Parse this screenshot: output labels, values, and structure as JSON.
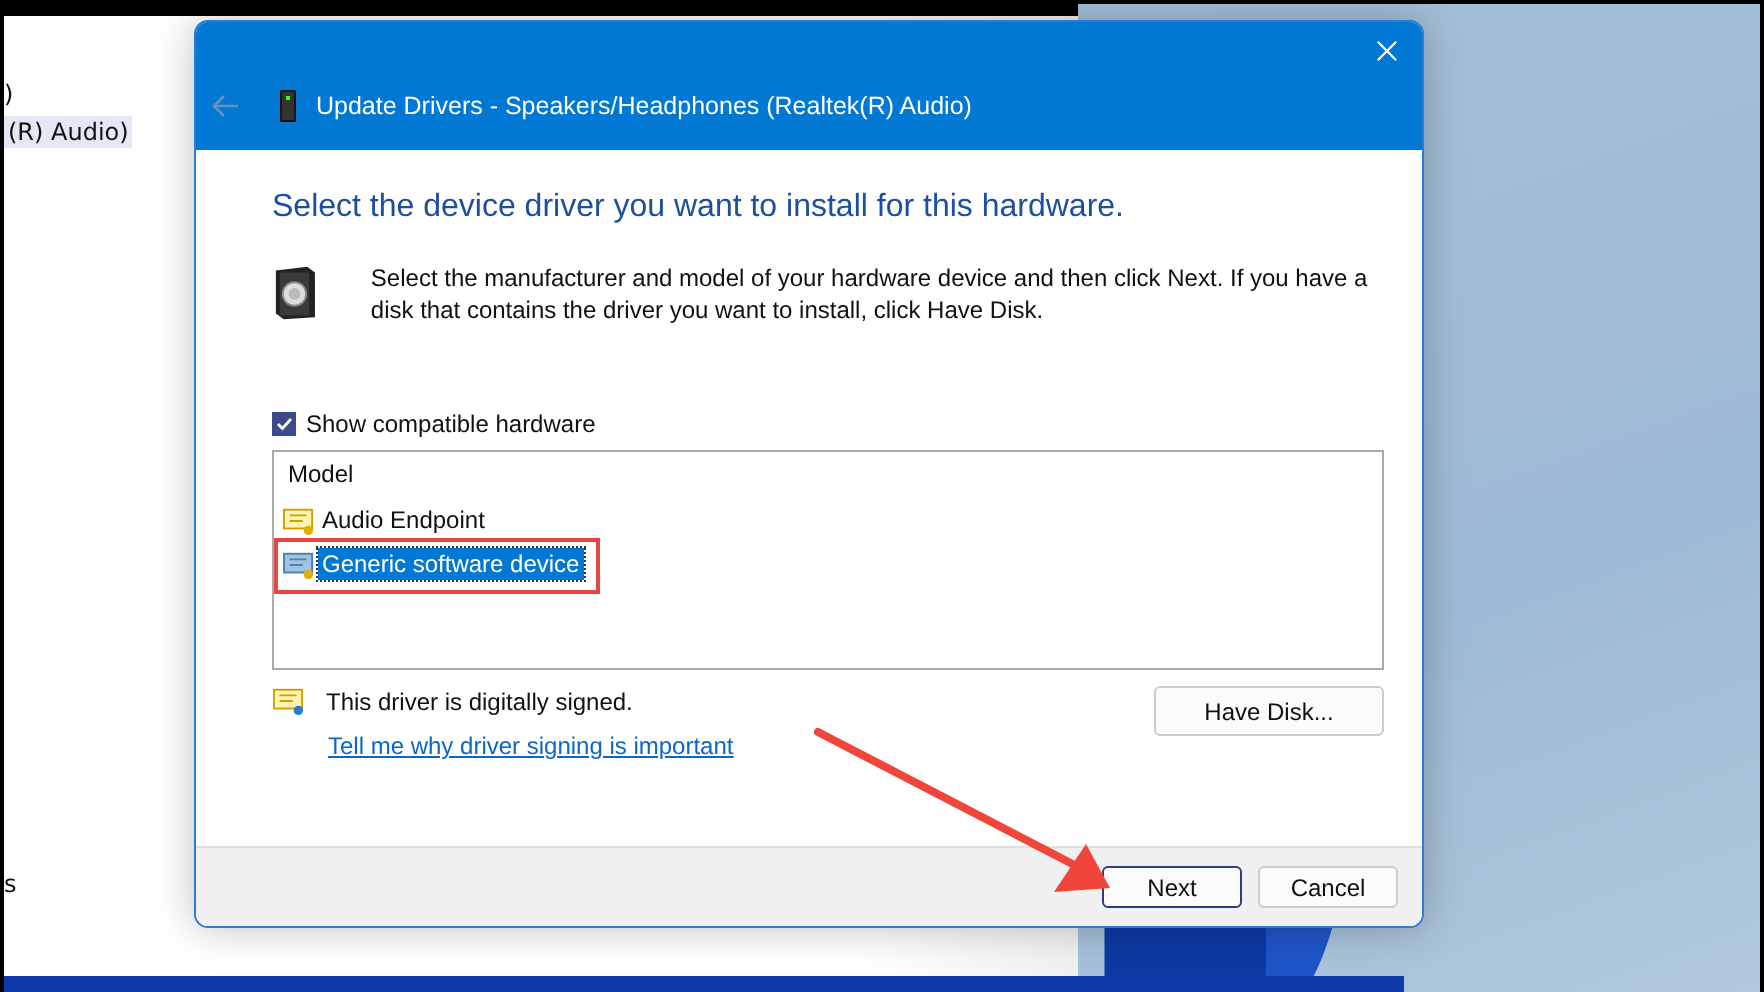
{
  "background_window": {
    "lines": [
      ")",
      "(R) Audio)",
      "s"
    ]
  },
  "dialog": {
    "title": "Update Drivers - Speakers/Headphones (Realtek(R) Audio)",
    "heading": "Select the device driver you want to install for this hardware.",
    "description": "Select the manufacturer and model of your hardware device and then click Next. If you have a disk that contains the driver you want to install, click Have Disk.",
    "show_compatible": {
      "label": "Show compatible hardware",
      "checked": true
    },
    "list": {
      "column": "Model",
      "items": [
        {
          "label": "Audio Endpoint",
          "selected": false
        },
        {
          "label": "Generic software device",
          "selected": true
        }
      ]
    },
    "signed_text": "This driver is digitally signed.",
    "link": "Tell me why driver signing is important",
    "have_disk": "Have Disk...",
    "buttons": [
      {
        "label": "Next",
        "default": true
      },
      {
        "label": "Cancel",
        "default": false
      }
    ]
  }
}
